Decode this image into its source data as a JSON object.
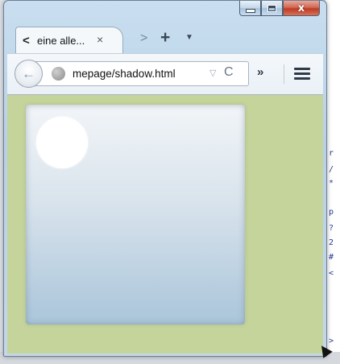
{
  "window": {
    "caption": {
      "minimize_icon": "minimize-icon",
      "maximize_icon": "maximize-icon",
      "close_icon": "close-icon",
      "close_glyph": "x"
    }
  },
  "tabs": {
    "scroll_left_glyph": "<",
    "active_tab_title": "eine alle...",
    "close_glyph": "×",
    "scroll_right_glyph": ">",
    "new_tab_glyph": "+",
    "all_tabs_glyph": "▼"
  },
  "navbar": {
    "back_glyph": "←",
    "url": "mepage/shadow.html",
    "dropmarker_glyph": "▽",
    "reload_glyph": "C",
    "overflow_glyph": "»"
  },
  "background_glyphs": [
    "r",
    "/",
    "*",
    "p",
    "?",
    "2",
    "#",
    "<",
    ">"
  ],
  "colors": {
    "page_background": "#c5d49b",
    "box_top": "#f2f5f8",
    "box_bottom": "#aac5da",
    "circle": "#ffffff",
    "close_button": "#c9442b"
  }
}
